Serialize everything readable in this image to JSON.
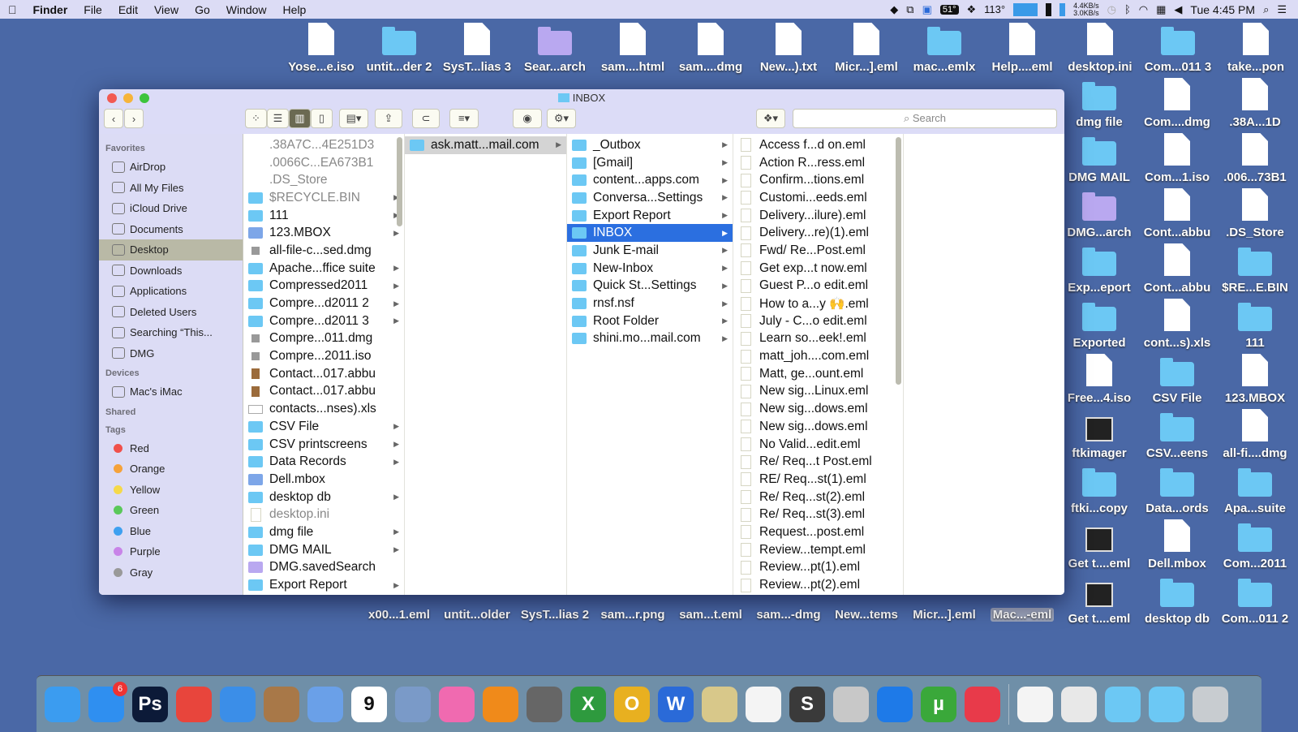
{
  "menubar": {
    "apple": "",
    "app": "Finder",
    "items": [
      "File",
      "Edit",
      "View",
      "Go",
      "Window",
      "Help"
    ],
    "status": {
      "temp_cpu": "51°",
      "temp_sensor": "113°",
      "net_up": "4.4KB/s",
      "net_down": "3.0KB/s",
      "clock": "Tue 4:45 PM"
    }
  },
  "window": {
    "title": "INBOX",
    "search_placeholder": "Search"
  },
  "sidebar": {
    "favorites_label": "Favorites",
    "favorites": [
      "AirDrop",
      "All My Files",
      "iCloud Drive",
      "Documents",
      "Desktop",
      "Downloads",
      "Applications",
      "Deleted Users",
      "Searching “This...",
      "DMG"
    ],
    "selected": "Desktop",
    "devices_label": "Devices",
    "devices": [
      "Mac's iMac"
    ],
    "shared_label": "Shared",
    "tags_label": "Tags",
    "tags": [
      {
        "name": "Red",
        "color": "#f0504a"
      },
      {
        "name": "Orange",
        "color": "#f5a23a"
      },
      {
        "name": "Yellow",
        "color": "#f5d94a"
      },
      {
        "name": "Green",
        "color": "#5ac85a"
      },
      {
        "name": "Blue",
        "color": "#3ea0f0"
      },
      {
        "name": "Purple",
        "color": "#c884e8"
      },
      {
        "name": "Gray",
        "color": "#999999"
      }
    ]
  },
  "columns": [
    [
      {
        "n": ".38A7C...4E251D3",
        "t": "hidden",
        "dim": true
      },
      {
        "n": ".0066C...EA673B1",
        "t": "hidden",
        "dim": true
      },
      {
        "n": ".DS_Store",
        "t": "hidden",
        "dim": true
      },
      {
        "n": "$RECYCLE.BIN",
        "t": "folder",
        "dim": true,
        "a": true
      },
      {
        "n": "111",
        "t": "folder",
        "a": true
      },
      {
        "n": "123.MBOX",
        "t": "mbox",
        "a": true
      },
      {
        "n": "all-file-c...sed.dmg",
        "t": "dmg"
      },
      {
        "n": "Apache...ffice suite",
        "t": "folder",
        "a": true
      },
      {
        "n": "Compressed2011",
        "t": "folder",
        "a": true
      },
      {
        "n": "Compre...d2011 2",
        "t": "folder",
        "a": true
      },
      {
        "n": "Compre...d2011 3",
        "t": "folder",
        "a": true
      },
      {
        "n": "Compre...011.dmg",
        "t": "dmg"
      },
      {
        "n": "Compre...2011.iso",
        "t": "dmg"
      },
      {
        "n": "Contact...017.abbu",
        "t": "abbu"
      },
      {
        "n": "Contact...017.abbu",
        "t": "abbu"
      },
      {
        "n": "contacts...nses).xls",
        "t": "xls"
      },
      {
        "n": "CSV File",
        "t": "folder",
        "a": true
      },
      {
        "n": "CSV printscreens",
        "t": "folder",
        "a": true
      },
      {
        "n": "Data Records",
        "t": "folder",
        "a": true
      },
      {
        "n": "Dell.mbox",
        "t": "mbox"
      },
      {
        "n": "desktop db",
        "t": "folder",
        "a": true
      },
      {
        "n": "desktop.ini",
        "t": "doc",
        "dim": true
      },
      {
        "n": "dmg file",
        "t": "folder",
        "a": true
      },
      {
        "n": "DMG MAIL",
        "t": "folder",
        "a": true
      },
      {
        "n": "DMG.savedSearch",
        "t": "purple"
      },
      {
        "n": "Export Report",
        "t": "folder",
        "a": true
      }
    ],
    [
      {
        "n": "ask.matt...mail.com",
        "t": "folder",
        "a": true,
        "sel": "gray"
      }
    ],
    [
      {
        "n": "_Outbox",
        "t": "folder",
        "a": true
      },
      {
        "n": "[Gmail]",
        "t": "folder",
        "a": true
      },
      {
        "n": "content...apps.com",
        "t": "folder",
        "a": true
      },
      {
        "n": "Conversa...Settings",
        "t": "folder",
        "a": true
      },
      {
        "n": "Export Report",
        "t": "folder",
        "a": true
      },
      {
        "n": "INBOX",
        "t": "folder",
        "a": true,
        "sel": "blue"
      },
      {
        "n": "Junk E-mail",
        "t": "folder",
        "a": true
      },
      {
        "n": "New-Inbox",
        "t": "folder",
        "a": true
      },
      {
        "n": "Quick St...Settings",
        "t": "folder",
        "a": true
      },
      {
        "n": "rnsf.nsf",
        "t": "folder",
        "a": true
      },
      {
        "n": "Root Folder",
        "t": "folder",
        "a": true
      },
      {
        "n": "shini.mo...mail.com",
        "t": "folder",
        "a": true
      }
    ],
    [
      {
        "n": "Access f...d on.eml",
        "t": "doc"
      },
      {
        "n": "Action R...ress.eml",
        "t": "doc"
      },
      {
        "n": "Confirm...tions.eml",
        "t": "doc"
      },
      {
        "n": "Customi...eeds.eml",
        "t": "doc"
      },
      {
        "n": "Delivery...ilure).eml",
        "t": "doc"
      },
      {
        "n": "Delivery...re)(1).eml",
        "t": "doc"
      },
      {
        "n": "Fwd/ Re...Post.eml",
        "t": "doc"
      },
      {
        "n": "Get exp...t now.eml",
        "t": "doc"
      },
      {
        "n": "Guest P...o edit.eml",
        "t": "doc"
      },
      {
        "n": "How to a...y 🙌.eml",
        "t": "doc"
      },
      {
        "n": "July - C...o edit.eml",
        "t": "doc"
      },
      {
        "n": "Learn so...eek!.eml",
        "t": "doc"
      },
      {
        "n": "matt_joh....com.eml",
        "t": "doc"
      },
      {
        "n": "Matt, ge...ount.eml",
        "t": "doc"
      },
      {
        "n": "New sig...Linux.eml",
        "t": "doc"
      },
      {
        "n": "New sig...dows.eml",
        "t": "doc"
      },
      {
        "n": "New sig...dows.eml",
        "t": "doc"
      },
      {
        "n": "No Valid...edit.eml",
        "t": "doc"
      },
      {
        "n": "Re/ Req...t Post.eml",
        "t": "doc"
      },
      {
        "n": "RE/ Req...st(1).eml",
        "t": "doc"
      },
      {
        "n": "Re/ Req...st(2).eml",
        "t": "doc"
      },
      {
        "n": "Re/ Req...st(3).eml",
        "t": "doc"
      },
      {
        "n": "Request...post.eml",
        "t": "doc"
      },
      {
        "n": "Review...tempt.eml",
        "t": "doc"
      },
      {
        "n": "Review...pt(1).eml",
        "t": "doc"
      },
      {
        "n": "Review...pt(2).eml",
        "t": "doc"
      }
    ]
  ],
  "desktop": {
    "top_row": [
      {
        "n": "Yose...e.iso",
        "t": "doc"
      },
      {
        "n": "untit...der 2",
        "t": "folder"
      },
      {
        "n": "SysT...lias 3",
        "t": "doc"
      },
      {
        "n": "Sear...arch",
        "t": "purple"
      },
      {
        "n": "sam....html",
        "t": "doc"
      },
      {
        "n": "sam....dmg",
        "t": "doc"
      },
      {
        "n": "New...).txt",
        "t": "doc"
      },
      {
        "n": "Micr...].eml",
        "t": "doc"
      },
      {
        "n": "mac...emlx",
        "t": "folder"
      },
      {
        "n": "Help....eml",
        "t": "doc"
      },
      {
        "n": "desktop.ini",
        "t": "doc"
      },
      {
        "n": "Com...011 3",
        "t": "folder"
      },
      {
        "n": "take...pon",
        "t": "doc"
      }
    ],
    "grid": [
      [
        "dmg file",
        "folder"
      ],
      [
        "Com....dmg",
        "doc"
      ],
      [
        ".38A...1D",
        "doc"
      ],
      [
        "DMG MAIL",
        "folder"
      ],
      [
        "Com...1.iso",
        "doc"
      ],
      [
        ".006...73B1",
        "doc"
      ],
      [
        "DMG...arch",
        "purple"
      ],
      [
        "Cont...abbu",
        "doc"
      ],
      [
        ".DS_Store",
        "doc"
      ],
      [
        "Exp...eport",
        "folder"
      ],
      [
        "Cont...abbu",
        "doc"
      ],
      [
        "$RE...E.BIN",
        "folder"
      ],
      [
        "Exported",
        "folder"
      ],
      [
        "cont...s).xls",
        "doc"
      ],
      [
        "111",
        "folder"
      ],
      [
        "Free...4.iso",
        "doc"
      ],
      [
        "CSV File",
        "folder"
      ],
      [
        "123.MBOX",
        "doc"
      ],
      [
        "ftkimager",
        "black"
      ],
      [
        "CSV...eens",
        "folder"
      ],
      [
        "all-fi....dmg",
        "doc"
      ],
      [
        "ftki...copy",
        "folder"
      ],
      [
        "Data...ords",
        "folder"
      ],
      [
        "Apa...suite",
        "folder"
      ],
      [
        "Get t....eml",
        "black"
      ],
      [
        "Dell.mbox",
        "doc"
      ],
      [
        "Com...2011",
        "folder"
      ],
      [
        "Get t....eml",
        "black"
      ],
      [
        "desktop db",
        "folder"
      ],
      [
        "Com...011 2",
        "folder"
      ]
    ],
    "bottom_row": [
      {
        "n": "x00...1.eml"
      },
      {
        "n": "untit...older"
      },
      {
        "n": "SysT...lias 2"
      },
      {
        "n": "sam...r.png"
      },
      {
        "n": "sam...t.eml"
      },
      {
        "n": "sam...-dmg"
      },
      {
        "n": "New...tems"
      },
      {
        "n": "Micr...].eml"
      },
      {
        "n": "Mac...-eml",
        "sel": true
      }
    ]
  },
  "dock": {
    "apps": [
      {
        "name": "Finder",
        "color": "#3b9cf0"
      },
      {
        "name": "App Store",
        "color": "#2f8ff0",
        "badge": "6"
      },
      {
        "name": "Photoshop",
        "color": "#0c1a38",
        "label": "Ps"
      },
      {
        "name": "Chrome",
        "color": "#e8453c"
      },
      {
        "name": "Safari",
        "color": "#3b8ee8"
      },
      {
        "name": "Contacts",
        "color": "#a87848"
      },
      {
        "name": "Mail",
        "color": "#6aa0e8"
      },
      {
        "name": "Calendar",
        "color": "#ffffff",
        "label": "9"
      },
      {
        "name": "Preview",
        "color": "#7a9ac8"
      },
      {
        "name": "iTunes",
        "color": "#f06ab0"
      },
      {
        "name": "iBooks",
        "color": "#f08a1a"
      },
      {
        "name": "System Preferences",
        "color": "#666666"
      },
      {
        "name": "Excel",
        "color": "#2e9a3e",
        "label": "X"
      },
      {
        "name": "Outlook",
        "color": "#e8b020",
        "label": "O"
      },
      {
        "name": "Word",
        "color": "#2a6ad8",
        "label": "W"
      },
      {
        "name": "Notes",
        "color": "#d8c88a"
      },
      {
        "name": "Photos",
        "color": "#f4f4f4"
      },
      {
        "name": "Sublime",
        "color": "#3a3a3a",
        "label": "S"
      },
      {
        "name": "Scissors",
        "color": "#c8c8c8"
      },
      {
        "name": "TeamViewer",
        "color": "#1e7ae8"
      },
      {
        "name": "uTorrent",
        "color": "#3aa83a",
        "label": "µ"
      },
      {
        "name": "Diamond",
        "color": "#e83a4a"
      }
    ],
    "stack": [
      {
        "name": "Document",
        "color": "#f4f4f4"
      },
      {
        "name": "Disk Image",
        "color": "#e8e8e8"
      },
      {
        "name": "Applications Folder",
        "color": "#6cc8f4"
      },
      {
        "name": "Windows Folder",
        "color": "#6cc8f4"
      },
      {
        "name": "Trash",
        "color": "#c8ccd0"
      }
    ]
  }
}
